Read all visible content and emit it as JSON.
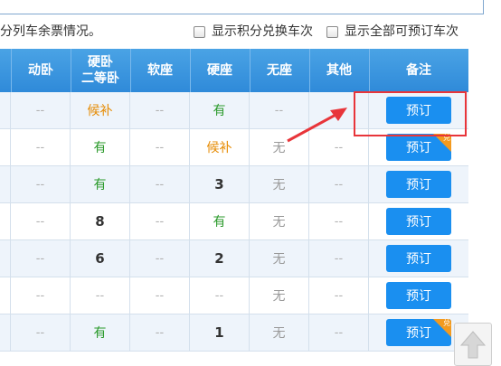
{
  "info": {
    "text": "分列车余票情况。",
    "opt1": "显示积分兑换车次",
    "opt2": "显示全部可预订车次"
  },
  "headers": [
    "动卧",
    "硬卧\n二等卧",
    "软座",
    "硬座",
    "无座",
    "其他",
    "备注"
  ],
  "header_lines": {
    "h2a": "硬卧",
    "h2b": "二等卧"
  },
  "rows": [
    {
      "c0": "--",
      "c1": "候补",
      "c2": "--",
      "c3": "有",
      "c4": "--",
      "c5": "",
      "btn": "预订",
      "badge": false
    },
    {
      "c0": "--",
      "c1": "有",
      "c2": "--",
      "c3": "候补",
      "c4": "无",
      "c5": "--",
      "btn": "预订",
      "badge": true
    },
    {
      "c0": "--",
      "c1": "有",
      "c2": "--",
      "c3": "3",
      "c4": "无",
      "c5": "--",
      "btn": "预订",
      "badge": false
    },
    {
      "c0": "--",
      "c1": "8",
      "c2": "--",
      "c3": "有",
      "c4": "无",
      "c5": "--",
      "btn": "预订",
      "badge": false
    },
    {
      "c0": "--",
      "c1": "6",
      "c2": "--",
      "c3": "2",
      "c4": "无",
      "c5": "--",
      "btn": "预订",
      "badge": false
    },
    {
      "c0": "--",
      "c1": "--",
      "c2": "--",
      "c3": "--",
      "c4": "无",
      "c5": "--",
      "btn": "预订",
      "badge": false
    },
    {
      "c0": "--",
      "c1": "有",
      "c2": "--",
      "c3": "1",
      "c4": "无",
      "c5": "--",
      "btn": "预订",
      "badge": true
    }
  ],
  "badge_text": "兑",
  "colors": {
    "header": "#2f8ad9",
    "button": "#1a8ff0",
    "badge": "#f39a1f",
    "highlight": "#e8353a"
  }
}
